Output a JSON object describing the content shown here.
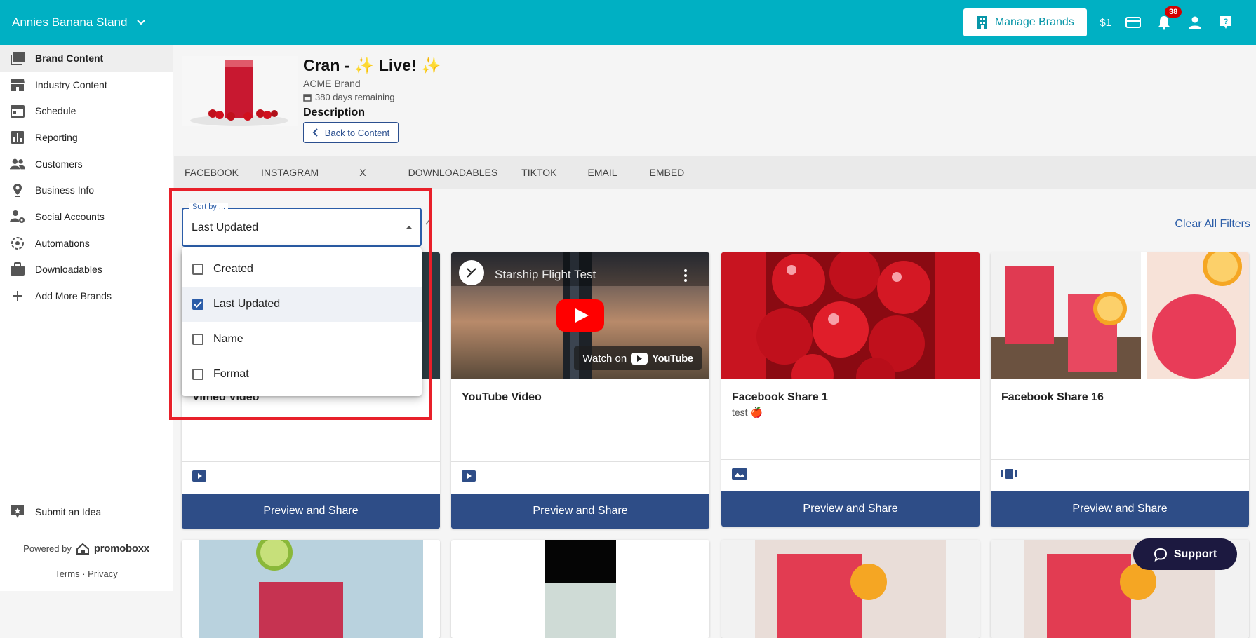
{
  "topbar": {
    "brand_name": "Annies Banana Stand",
    "manage_brands_label": "Manage Brands",
    "credits": "$1",
    "notification_count": "38",
    "bg_color": "#00b0c3"
  },
  "sidebar": {
    "items": [
      {
        "label": "Brand Content",
        "icon": "library-icon",
        "active": true
      },
      {
        "label": "Industry Content",
        "icon": "store-icon"
      },
      {
        "label": "Schedule",
        "icon": "calendar-icon"
      },
      {
        "label": "Reporting",
        "icon": "bar-chart-icon"
      },
      {
        "label": "Customers",
        "icon": "people-icon"
      },
      {
        "label": "Business Info",
        "icon": "location-pin-icon"
      },
      {
        "label": "Social Accounts",
        "icon": "person-gear-icon"
      },
      {
        "label": "Automations",
        "icon": "automation-icon"
      },
      {
        "label": "Downloadables",
        "icon": "briefcase-icon"
      },
      {
        "label": "Add More Brands",
        "icon": "plus-icon"
      }
    ],
    "submit_idea": "Submit an Idea",
    "powered_by": "Powered by",
    "logo_text": "promoboxx",
    "terms": "Terms",
    "separator": "·",
    "privacy": "Privacy"
  },
  "header": {
    "title": "Cran - ✨ Live! ✨",
    "brand": "ACME Brand",
    "days_remaining": "380 days remaining",
    "description_label": "Description",
    "back_label": "Back to Content"
  },
  "tabs": [
    "FACEBOOK",
    "INSTAGRAM",
    "X",
    "DOWNLOADABLES",
    "TIKTOK",
    "EMAIL",
    "EMBED"
  ],
  "sort": {
    "label": "Sort by ...",
    "value": "Last Updated",
    "options": [
      {
        "label": "Created",
        "checked": false
      },
      {
        "label": "Last Updated",
        "checked": true
      },
      {
        "label": "Name",
        "checked": false
      },
      {
        "label": "Format",
        "checked": false
      }
    ]
  },
  "clear_filters": "Clear All Filters",
  "cards": [
    {
      "title": "Vimeo Video",
      "desc": "",
      "type_icon": "video-icon",
      "action": "Preview and Share"
    },
    {
      "title": "YouTube Video",
      "desc": "",
      "type_icon": "video-icon",
      "action": "Preview and Share",
      "video_title": "Starship Flight Test",
      "watch_on": "Watch on",
      "yt_word": "YouTube"
    },
    {
      "title": "Facebook Share 1",
      "desc": "test 🍎",
      "type_icon": "image-icon",
      "action": "Preview and Share"
    },
    {
      "title": "Facebook Share 16",
      "desc": "",
      "type_icon": "carousel-icon",
      "action": "Preview and Share"
    }
  ],
  "support_label": "Support",
  "colors": {
    "accent": "#00b0c3",
    "primary": "#2e4d87",
    "highlight": "#e8202a"
  }
}
